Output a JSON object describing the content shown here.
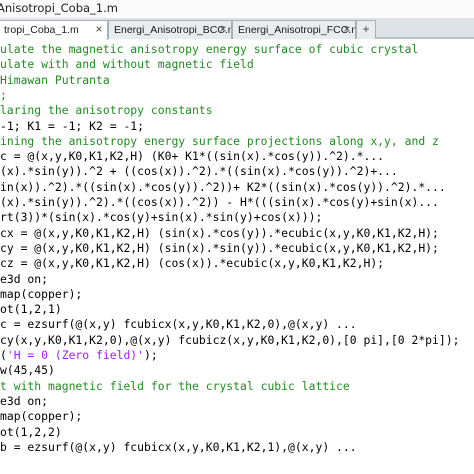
{
  "window": {
    "title": "Anisotropi_Coba_1.m"
  },
  "tabs": [
    {
      "label": "tropi_Coba_1.m",
      "active": true
    },
    {
      "label": "Energi_Anisotropi_BCC.m",
      "active": false
    },
    {
      "label": "Energi_Anisotropi_FCC.m",
      "active": false
    }
  ],
  "tab_close_glyph": "×",
  "tab_more_glyph": "+",
  "code_lines": [
    [
      {
        "t": "ulate the magnetic anisotropy energy surface of cubic crystal",
        "c": "c"
      }
    ],
    [
      {
        "t": "ulate with and without magnetic field",
        "c": "c"
      }
    ],
    [
      {
        "t": "Himawan Putranta",
        "c": "c"
      }
    ],
    [
      {
        "t": ";",
        "c": "c"
      }
    ],
    [
      {
        "t": "laring the anisotropy constants",
        "c": "c"
      }
    ],
    [
      {
        "t": "-1; K1 = -1; K2 = -1;",
        "c": ""
      }
    ],
    [
      {
        "t": "ining the anisotropy energy surface projections along x,y, and z",
        "c": "c"
      }
    ],
    [
      {
        "t": "c = @(x,y,K0,K1,K2,H) (K0+ K1*((sin(x).*cos(y)).^2).*...",
        "c": ""
      }
    ],
    [
      {
        "t": "(x).*sin(y)).^2 + ((cos(x)).^2).*((sin(x).*cos(y)).^2)+...",
        "c": ""
      }
    ],
    [
      {
        "t": "in(x)).^2).*((sin(x).*cos(y)).^2))+ K2*((sin(x).*cos(y)).^2).*...",
        "c": ""
      }
    ],
    [
      {
        "t": "(x).*sin(y)).^2).*((cos(x)).^2)) - H*(((sin(x).*cos(y)+sin(x)...",
        "c": ""
      }
    ],
    [
      {
        "t": "rt(3))*(sin(x).*cos(y)+sin(x).*sin(y)+cos(x)));",
        "c": ""
      }
    ],
    [
      {
        "t": "cx = @(x,y,K0,K1,K2,H) (sin(x).*cos(y)).*ecubic(x,y,K0,K1,K2,H);",
        "c": ""
      }
    ],
    [
      {
        "t": "cy = @(x,y,K0,K1,K2,H) (sin(x).*sin(y)).*ecubic(x,y,K0,K1,K2,H);",
        "c": ""
      }
    ],
    [
      {
        "t": "cz = @(x,y,K0,K1,K2,H) (cos(x)).*ecubic(x,y,K0,K1,K2,H);",
        "c": ""
      }
    ],
    [
      {
        "t": "e3d on;",
        "c": ""
      }
    ],
    [
      {
        "t": "map(copper);",
        "c": ""
      }
    ],
    [
      {
        "t": "ot(1,2,1)",
        "c": ""
      }
    ],
    [
      {
        "t": "c = ezsurf(@(x,y) fcubicx(x,y,K0,K1,K2,0),@(x,y) ...",
        "c": ""
      }
    ],
    [
      {
        "t": "cy(x,y,K0,K1,K2,0),@(x,y) fcubicz(x,y,K0,K1,K2,0),[0 pi],[0 2*pi]);",
        "c": ""
      }
    ],
    [
      {
        "t": "(",
        "c": ""
      },
      {
        "t": "'H = 0 (Zero field)'",
        "c": "s"
      },
      {
        "t": ");",
        "c": ""
      }
    ],
    [
      {
        "t": "w(45,45)",
        "c": ""
      }
    ],
    [
      {
        "t": "t with magnetic field for the crystal cubic lattice",
        "c": "c"
      }
    ],
    [
      {
        "t": "e3d on;",
        "c": ""
      }
    ],
    [
      {
        "t": "map(copper);",
        "c": ""
      }
    ],
    [
      {
        "t": "ot(1,2,2)",
        "c": ""
      }
    ],
    [
      {
        "t": "b = ezsurf(@(x,y) fcubicx(x,y,K0,K1,K2,1),@(x,y) ...",
        "c": ""
      }
    ]
  ]
}
